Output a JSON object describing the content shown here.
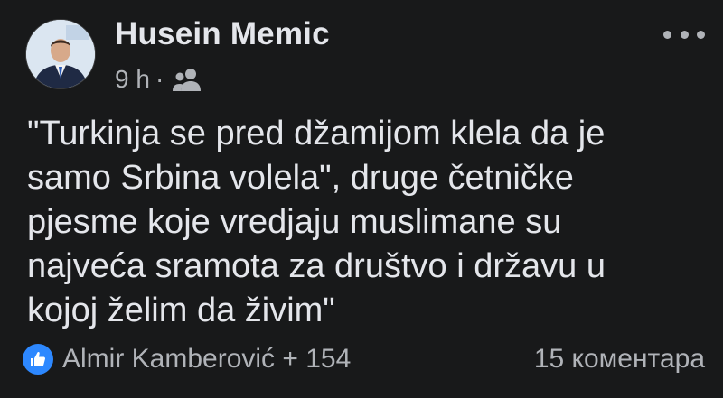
{
  "post": {
    "author": "Husein Memic",
    "time": "9 h",
    "separator": "·",
    "audience_icon": "friends-icon",
    "text": "\"Turkinja se pred džamijom klela da je samo Srbina volela\", druge četničke pjesme koje vredjaju muslimane su najveća sramota za društvo i državu u kojoj želim da živim\"",
    "text_lines": [
      "\"Turkinja se pred džamijom klela da je",
      "samo Srbina volela\", druge četničke",
      "pjesme koje vredjaju muslimane su",
      "najveća sramota za društvo i državu u",
      "kojoj želim da živim\""
    ]
  },
  "reactions": {
    "icon": "like-icon",
    "label": "Almir Kamberović + 154"
  },
  "comments": {
    "label": "15 коментара"
  },
  "colors": {
    "background": "#18191a",
    "primary_text": "#e4e6eb",
    "secondary_text": "#b0b3b8",
    "like_blue": "#2d88ff"
  }
}
